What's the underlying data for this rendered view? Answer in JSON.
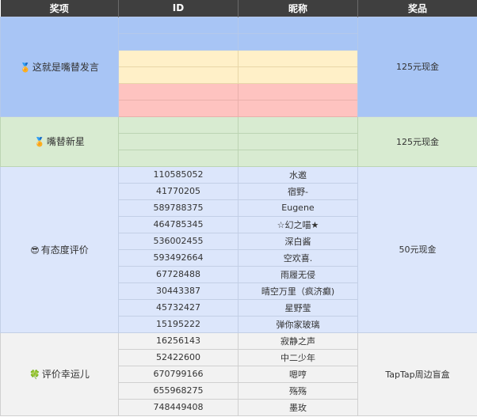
{
  "headers": [
    "奖项",
    "ID",
    "昵称",
    "奖品"
  ],
  "sections": [
    {
      "award": "这就是嘴替发言",
      "award_icon": "medal-icon",
      "prize": "125元现金",
      "rows": [
        {
          "id": "",
          "nickname": ""
        },
        {
          "id": "",
          "nickname": ""
        },
        {
          "id": "",
          "nickname": ""
        },
        {
          "id": "",
          "nickname": ""
        },
        {
          "id": "",
          "nickname": ""
        },
        {
          "id": "",
          "nickname": ""
        }
      ]
    },
    {
      "award": "嘴替新星",
      "award_icon": "medal-icon",
      "prize": "125元现金",
      "rows": [
        {
          "id": "",
          "nickname": ""
        },
        {
          "id": "",
          "nickname": ""
        },
        {
          "id": "",
          "nickname": ""
        }
      ]
    },
    {
      "award": "有态度评价",
      "award_icon": "sunglasses-icon",
      "prize": "50元现金",
      "rows": [
        {
          "id": "110585052",
          "nickname": "水邀"
        },
        {
          "id": "41770205",
          "nickname": "宿野-"
        },
        {
          "id": "589788375",
          "nickname": "Eugene"
        },
        {
          "id": "464785345",
          "nickname": "☆幻之喵★"
        },
        {
          "id": "536002455",
          "nickname": "深白酱"
        },
        {
          "id": "593492664",
          "nickname": "空欢喜."
        },
        {
          "id": "67728488",
          "nickname": "雨履无侵"
        },
        {
          "id": "30443387",
          "nickname": "晴空万里（疯济癫)"
        },
        {
          "id": "45732427",
          "nickname": "星野莹"
        },
        {
          "id": "15195222",
          "nickname": "弹你家玻璃"
        }
      ]
    },
    {
      "award": "评价幸运儿",
      "award_icon": "four-leaf-clover-icon",
      "prize": "TapTap周边盲盒",
      "rows": [
        {
          "id": "16256143",
          "nickname": "寂静之声"
        },
        {
          "id": "52422600",
          "nickname": "中二少年"
        },
        {
          "id": "670799166",
          "nickname": "嗯哼"
        },
        {
          "id": "655968275",
          "nickname": "殇殇"
        },
        {
          "id": "748449408",
          "nickname": "墨玫"
        }
      ]
    }
  ],
  "colors": {
    "header_bg": "#3f3f3f",
    "section1_pink": "#fec3c0",
    "section1_blue": "#a8c5f5",
    "section1_yellow": "#fff0c8",
    "section2_green": "#d8ebd1",
    "section3_blue": "#dce6fb",
    "section4_gray": "#f2f2f2"
  }
}
